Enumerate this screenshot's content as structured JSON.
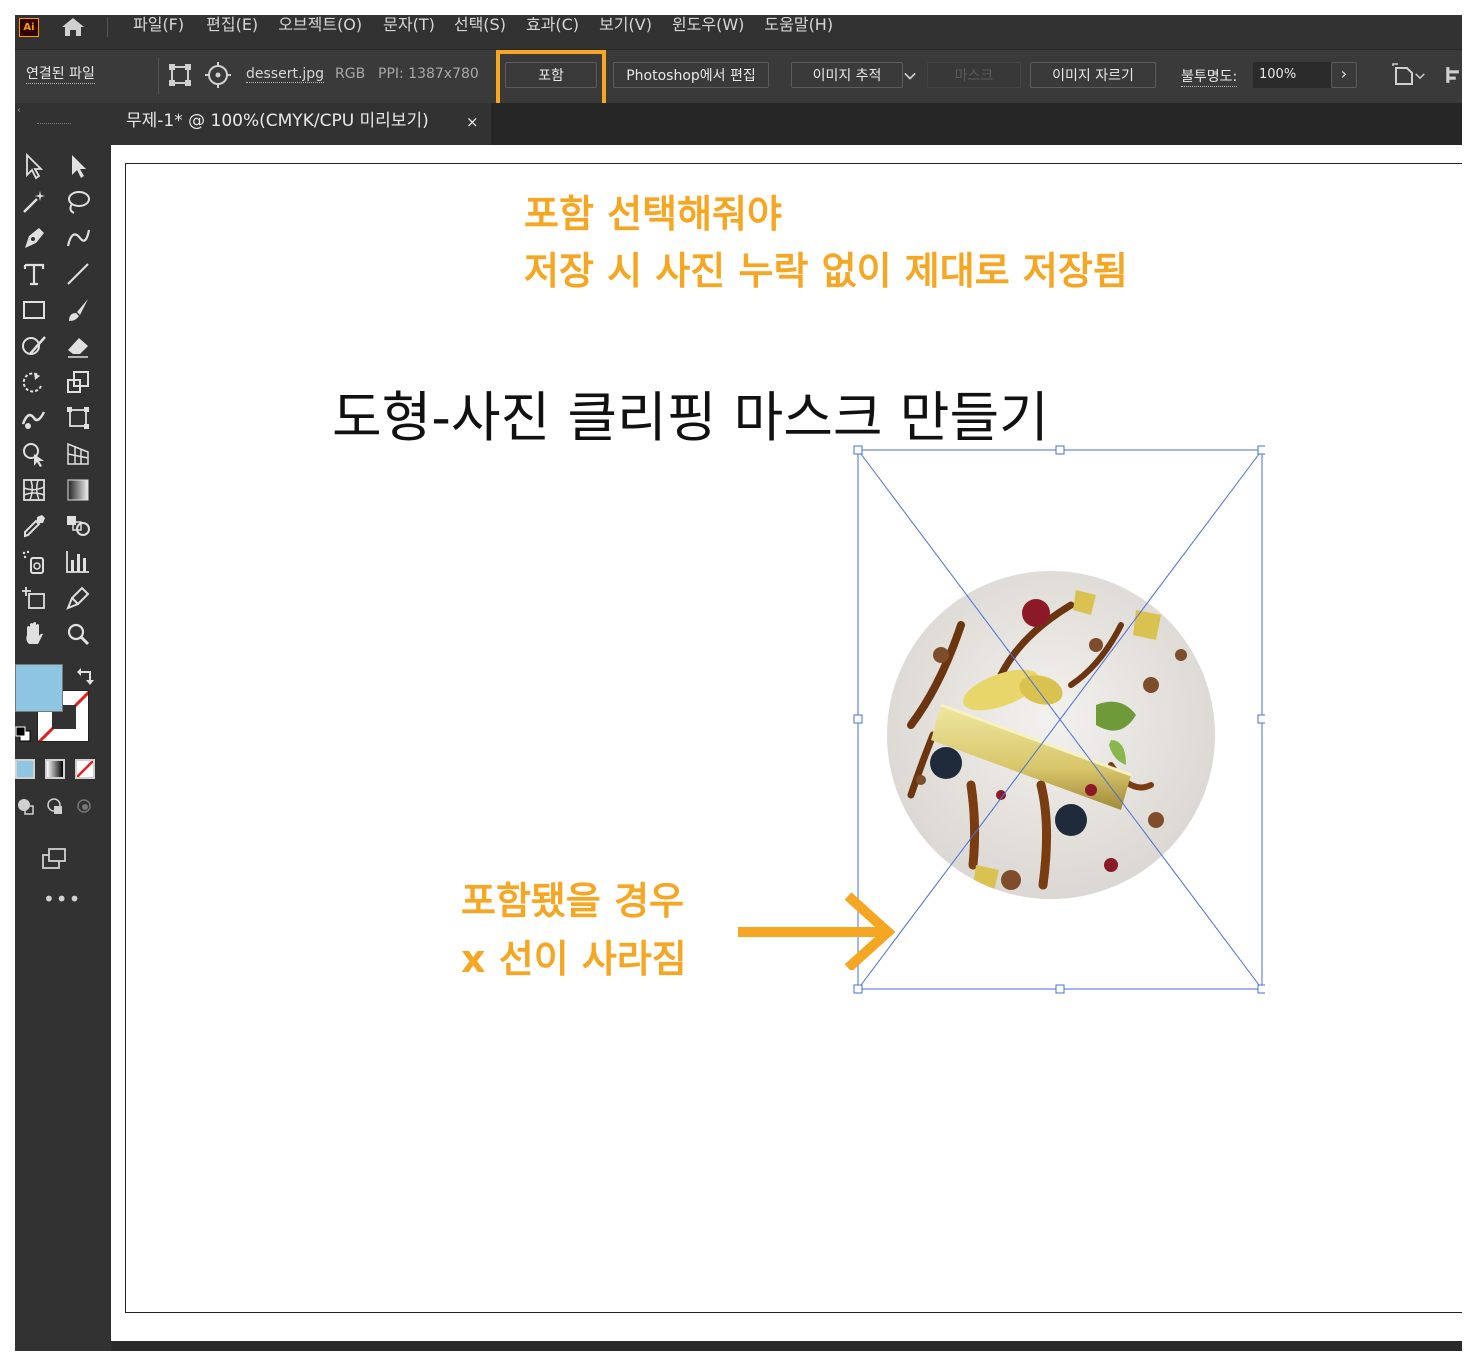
{
  "app": {
    "logo": "Ai"
  },
  "menu": [
    "파일(F)",
    "편집(E)",
    "오브젝트(O)",
    "문자(T)",
    "선택(S)",
    "효과(C)",
    "보기(V)",
    "윈도우(W)",
    "도움말(H)"
  ],
  "control": {
    "linked_file": "연결된 파일",
    "file_name": "dessert.jpg",
    "color_mode": "RGB",
    "ppi": "PPI: 1387x780",
    "embed_button": "포함",
    "edit_photoshop": "Photoshop에서 편집",
    "image_trace": "이미지 추적",
    "mask": "마스크",
    "crop_image": "이미지 자르기",
    "opacity_label": "불투명도:",
    "opacity_value": "100%"
  },
  "tab": {
    "title": "무제-1* @ 100%(CMYK/CPU 미리보기)",
    "close": "×"
  },
  "canvas": {
    "annotation_top_line1": "포함 선택해줘야",
    "annotation_top_line2": "저장 시 사진 누락 없이 제대로 저장됨",
    "heading": "도형-사진 클리핑 마스크 만들기",
    "annotation_bottom_line1": "포함됐을 경우",
    "annotation_bottom_line2": "x 선이 사라짐"
  },
  "colors": {
    "accent": "#f5a623",
    "fill": "#8ec5e3",
    "selection": "#4a6fd8"
  },
  "icons": [
    "home-icon",
    "selection-tool-icon",
    "direct-selection-icon",
    "magic-wand-icon",
    "lasso-icon",
    "pen-icon",
    "curvature-icon",
    "type-icon",
    "line-icon",
    "rectangle-icon",
    "paintbrush-icon",
    "shaper-icon",
    "eraser-icon",
    "rotate-icon",
    "scale-icon",
    "warp-icon",
    "free-transform-icon",
    "shape-builder-icon",
    "perspective-grid-icon",
    "mesh-icon",
    "gradient-icon",
    "eyedropper-icon",
    "blend-icon",
    "symbol-sprayer-icon",
    "graph-icon",
    "artboard-icon",
    "slice-icon",
    "hand-icon",
    "zoom-icon"
  ]
}
